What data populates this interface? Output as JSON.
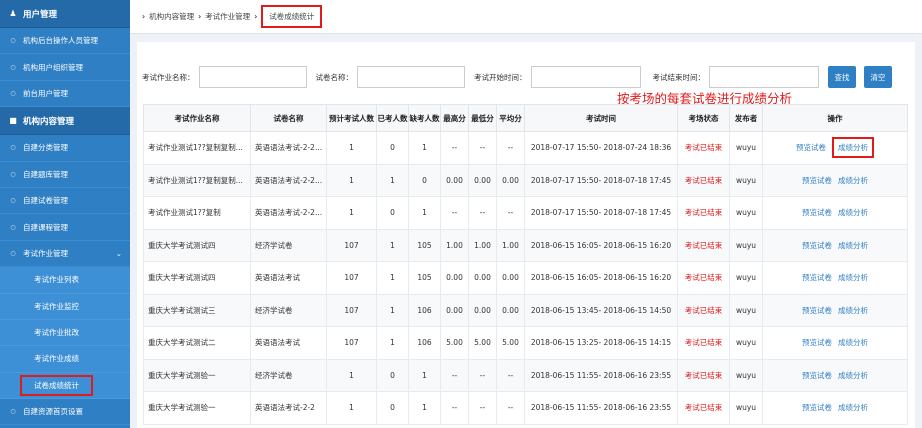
{
  "sidebar": {
    "group1": {
      "label": "用户管理",
      "icon": "user-icon"
    },
    "group1_items": [
      "机构后台操作人员管理",
      "机构用户组织管理",
      "前台用户管理"
    ],
    "group2": {
      "label": "机构内容管理",
      "icon": "folder-icon"
    },
    "group2_items": [
      "自建分类管理",
      "自建题库管理",
      "自建试卷管理",
      "自建课程管理"
    ],
    "exam_mgmt": {
      "label": "考试作业管理",
      "icon": "chevron-down-icon"
    },
    "exam_sub": [
      "考试作业列表",
      "考试作业监控",
      "考试作业批改",
      "考试作业成绩",
      "试卷成绩统计"
    ],
    "last_item": "自建资源首页设置"
  },
  "breadcrumb": [
    "机构内容管理",
    "考试作业管理",
    "试卷成绩统计"
  ],
  "filter": {
    "name_label": "考试作业名称：",
    "paper_label": "试卷名称：",
    "start_label": "考试开始时间：",
    "end_label": "考试结束时间：",
    "search_btn": "查找",
    "clear_btn": "清空"
  },
  "annotation": "按考场的每套试卷进行成绩分析",
  "table": {
    "headers": [
      "考试作业名称",
      "试卷名称",
      "预计考试人数",
      "已考人数",
      "缺考人数",
      "最高分",
      "最低分",
      "平均分",
      "考试时间",
      "考场状态",
      "发布者",
      "操作"
    ],
    "rows": [
      [
        "考试作业测试1??复制复制...",
        "英语语法考试-2-2...",
        "1",
        "0",
        "1",
        "--",
        "--",
        "--",
        "2018-07-17 15:50- 2018-07-24 18:36",
        "考试已结束",
        "wuyu"
      ],
      [
        "考试作业测试1??复制复制...",
        "英语语法考试-2-2...",
        "1",
        "1",
        "0",
        "0.00",
        "0.00",
        "0.00",
        "2018-07-17 15:50- 2018-07-18 17:45",
        "考试已结束",
        "wuyu"
      ],
      [
        "考试作业测试1??复制",
        "英语语法考试-2-2...",
        "1",
        "0",
        "1",
        "--",
        "--",
        "--",
        "2018-07-17 15:50- 2018-07-18 17:45",
        "考试已结束",
        "wuyu"
      ],
      [
        "重庆大学考试测试四",
        "经济学试卷",
        "107",
        "1",
        "105",
        "1.00",
        "1.00",
        "1.00",
        "2018-06-15 16:05- 2018-06-15 16:20",
        "考试已结束",
        "wuyu"
      ],
      [
        "重庆大学考试测试四",
        "英语语法考试",
        "107",
        "1",
        "105",
        "0.00",
        "0.00",
        "0.00",
        "2018-06-15 16:05- 2018-06-15 16:20",
        "考试已结束",
        "wuyu"
      ],
      [
        "重庆大学考试测试三",
        "经济学试卷",
        "107",
        "1",
        "106",
        "0.00",
        "0.00",
        "0.00",
        "2018-06-15 13:45- 2018-06-15 14:50",
        "考试已结束",
        "wuyu"
      ],
      [
        "重庆大学考试测试二",
        "英语语法考试",
        "107",
        "1",
        "106",
        "5.00",
        "5.00",
        "5.00",
        "2018-06-15 13:25- 2018-06-15 14:15",
        "考试已结束",
        "wuyu"
      ],
      [
        "重庆大学考试测验一",
        "经济学试卷",
        "1",
        "0",
        "1",
        "--",
        "--",
        "--",
        "2018-06-15 11:55- 2018-06-16 23:55",
        "考试已结束",
        "wuyu"
      ],
      [
        "重庆大学考试测验一",
        "英语语法考试-2-2",
        "1",
        "0",
        "1",
        "--",
        "--",
        "--",
        "2018-06-15 11:55- 2018-06-16 23:55",
        "考试已结束",
        "wuyu"
      ]
    ],
    "action_preview": "预览试卷",
    "action_analysis": "成绩分析"
  },
  "colors": {
    "sidebar": "#2f7fc4",
    "highlight": "#e01b1b",
    "status": "#e01b1b",
    "link": "#2f7fc4"
  }
}
